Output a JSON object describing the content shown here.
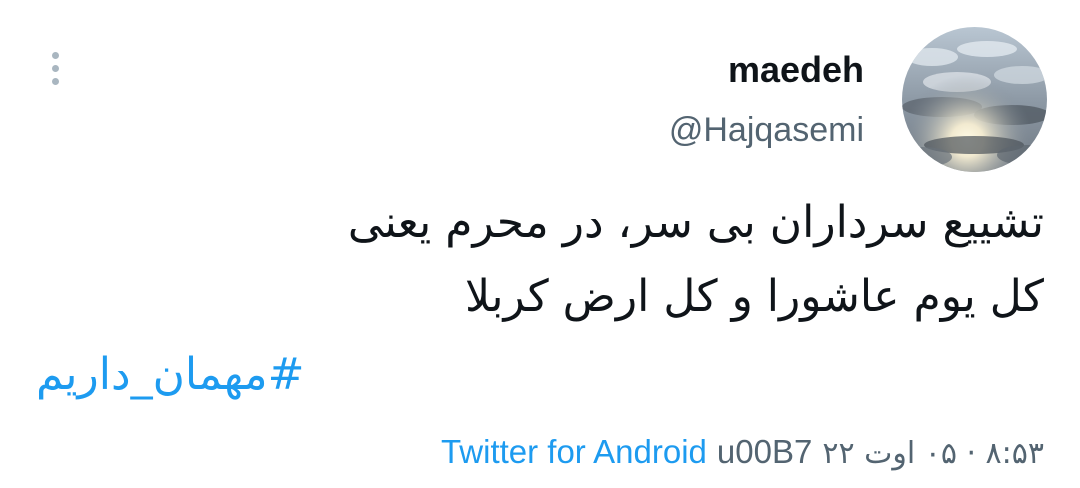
{
  "user": {
    "display_name": "maedeh",
    "handle": "@Hajqasemi",
    "avatar_icon": "sky-clouds-sunset-avatar"
  },
  "tweet": {
    "text_lines": [
      "تشییع سرداران بی سر، در محرم یعنی",
      "کل یوم عاشورا و کل ارض کربلا"
    ],
    "hashtag": "#مهمان_داریم"
  },
  "meta": {
    "datetime": "۸:۵۳ · ۰۵ اوت ۲۲",
    "separator": "u00B7",
    "source": "Twitter for Android"
  },
  "colors": {
    "link": "#1d9bf0",
    "secondary_text": "#536471",
    "primary_text": "#0f1419",
    "menu_dots": "#a9b6c0"
  }
}
